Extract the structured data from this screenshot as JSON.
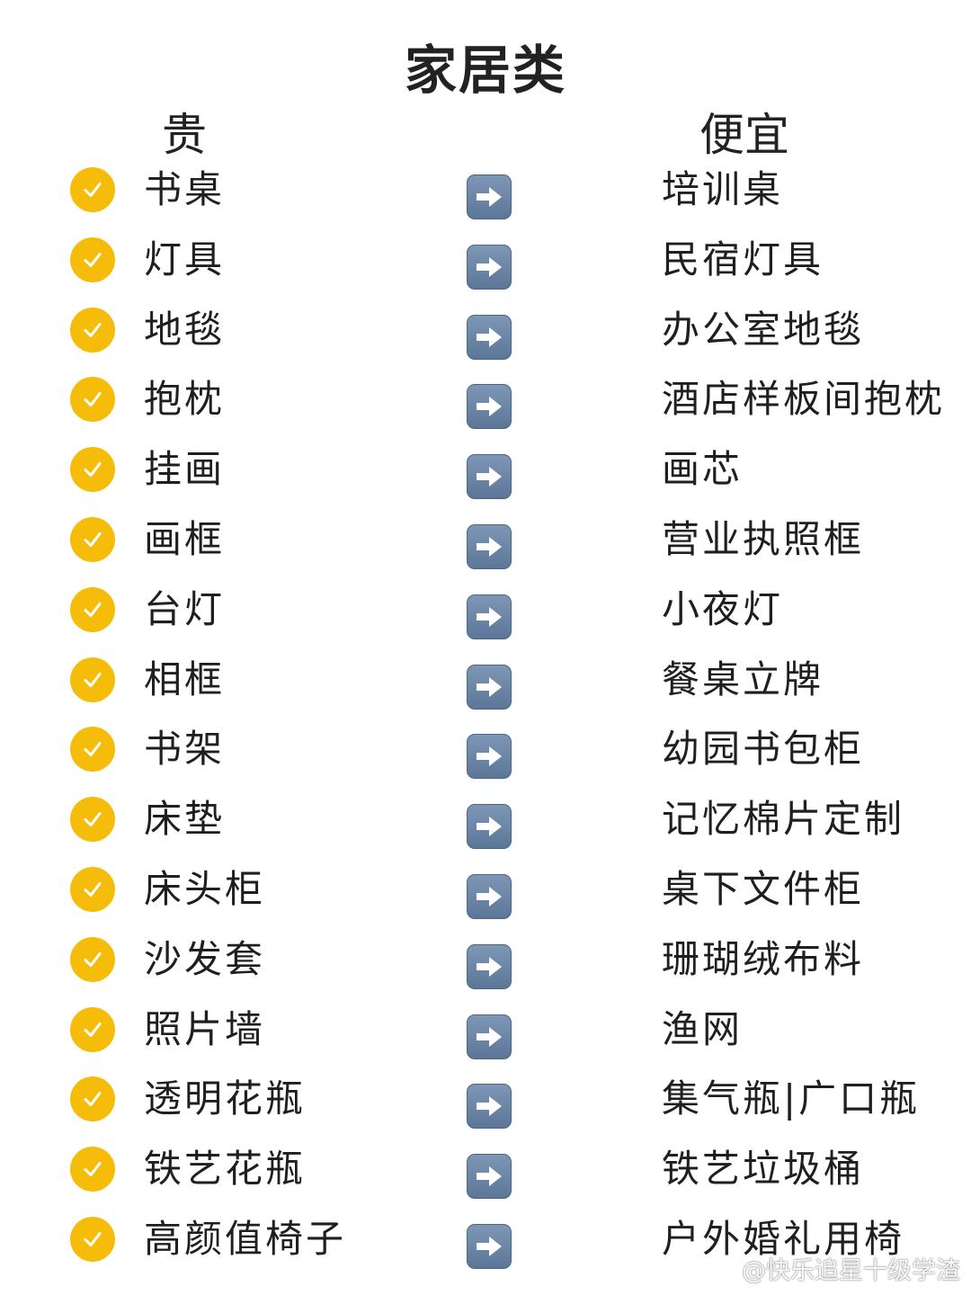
{
  "title": "家居类",
  "headers": {
    "expensive": "贵",
    "cheap": "便宜"
  },
  "rows": [
    {
      "expensive": "书桌",
      "cheap": "培训桌"
    },
    {
      "expensive": "灯具",
      "cheap": "民宿灯具"
    },
    {
      "expensive": "地毯",
      "cheap": "办公室地毯"
    },
    {
      "expensive": "抱枕",
      "cheap": "酒店样板间抱枕"
    },
    {
      "expensive": "挂画",
      "cheap": "画芯"
    },
    {
      "expensive": "画框",
      "cheap": "营业执照框"
    },
    {
      "expensive": "台灯",
      "cheap": "小夜灯"
    },
    {
      "expensive": "相框",
      "cheap": "餐桌立牌"
    },
    {
      "expensive": "书架",
      "cheap": "幼园书包柜"
    },
    {
      "expensive": "床垫",
      "cheap": "记忆棉片定制"
    },
    {
      "expensive": "床头柜",
      "cheap": "桌下文件柜"
    },
    {
      "expensive": "沙发套",
      "cheap": "珊瑚绒布料"
    },
    {
      "expensive": "照片墙",
      "cheap": "渔网"
    },
    {
      "expensive": "透明花瓶",
      "cheap": "集气瓶|广口瓶"
    },
    {
      "expensive": "铁艺花瓶",
      "cheap": "铁艺垃圾桶"
    },
    {
      "expensive": "高颜值椅子",
      "cheap": "户外婚礼用椅"
    }
  ],
  "icons": {
    "check": "check-circle-icon",
    "arrow": "right-arrow-icon"
  },
  "colors": {
    "check_bg": "#f5bd0a",
    "arrow_bg": "#6d87a8"
  },
  "watermark": "@快乐追星十级学渣"
}
